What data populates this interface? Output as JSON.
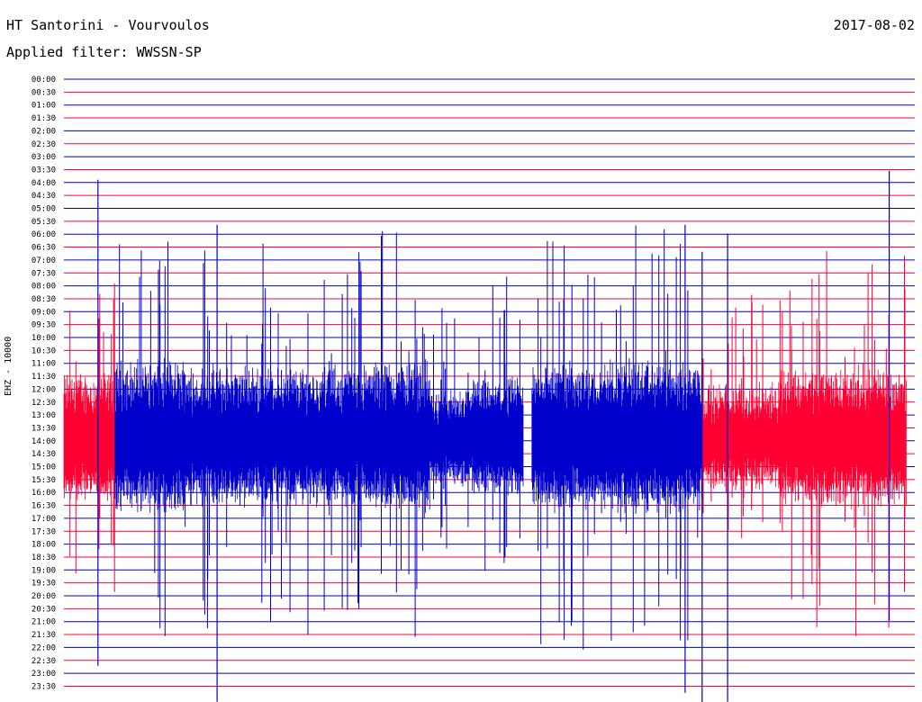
{
  "header": {
    "title": "HT Santorini - Vourvoulos",
    "date": "2017-08-02",
    "filter": "Applied filter: WWSSN-SP"
  },
  "colors": {
    "line_a": "#0000cc",
    "line_b": "#ff0033"
  },
  "chart_data": {
    "type": "helicorder",
    "ylabel": "EHZ - 10000",
    "row_labels": [
      "00:00",
      "00:30",
      "01:00",
      "01:30",
      "02:00",
      "02:30",
      "03:00",
      "03:30",
      "04:00",
      "04:30",
      "05:00",
      "05:30",
      "06:00",
      "06:30",
      "07:00",
      "07:30",
      "08:00",
      "08:30",
      "09:00",
      "09:30",
      "10:00",
      "10:30",
      "11:00",
      "11:30",
      "12:00",
      "12:30",
      "13:00",
      "13:30",
      "14:00",
      "14:30",
      "15:00",
      "15:30",
      "16:00",
      "16:30",
      "17:00",
      "17:30",
      "18:00",
      "18:30",
      "19:00",
      "19:30",
      "20:00",
      "20:30",
      "21:00",
      "21:30",
      "22:00",
      "22:30",
      "23:00",
      "23:30"
    ],
    "row_colors": [
      "blue",
      "red"
    ],
    "grid": true,
    "activity_segments": [
      {
        "x_from": 0.0,
        "x_to": 0.06,
        "color": "red",
        "intensity": 0.8
      },
      {
        "x_from": 0.06,
        "x_to": 0.15,
        "color": "blue",
        "intensity": 1.0
      },
      {
        "x_from": 0.15,
        "x_to": 0.25,
        "color": "blue",
        "intensity": 0.9
      },
      {
        "x_from": 0.25,
        "x_to": 0.36,
        "color": "blue",
        "intensity": 0.9
      },
      {
        "x_from": 0.36,
        "x_to": 0.43,
        "color": "blue",
        "intensity": 1.0
      },
      {
        "x_from": 0.43,
        "x_to": 0.48,
        "color": "blue",
        "intensity": 0.5
      },
      {
        "x_from": 0.48,
        "x_to": 0.54,
        "color": "blue",
        "intensity": 0.7
      },
      {
        "x_from": 0.55,
        "x_to": 0.7,
        "color": "blue",
        "intensity": 1.0
      },
      {
        "x_from": 0.7,
        "x_to": 0.75,
        "color": "blue",
        "intensity": 1.0
      },
      {
        "x_from": 0.75,
        "x_to": 0.84,
        "color": "red",
        "intensity": 0.6
      },
      {
        "x_from": 0.84,
        "x_to": 0.99,
        "color": "red",
        "intensity": 0.9
      }
    ]
  }
}
